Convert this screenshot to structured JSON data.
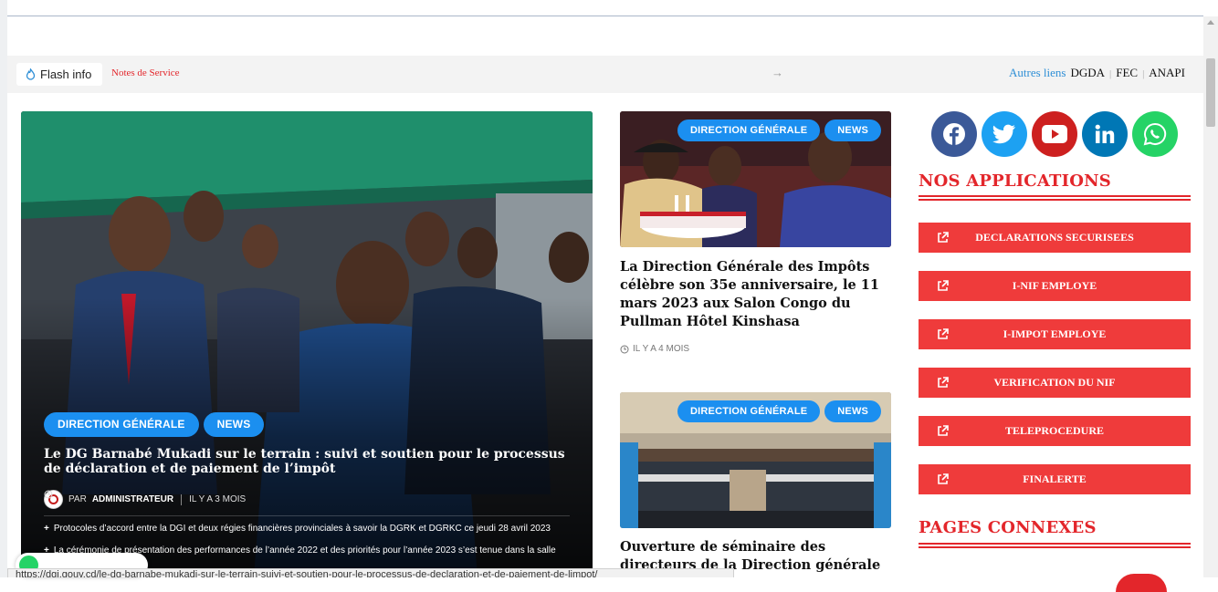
{
  "flash": {
    "label": "Flash info",
    "notes_link": "Notes de Service",
    "next_arrow": "→"
  },
  "links": {
    "label": "Autres liens",
    "items": [
      "DGDA",
      "FEC",
      "ANAPI"
    ],
    "separator": "|"
  },
  "hero": {
    "tags": [
      "DIRECTION GÉNÉRALE",
      "NEWS"
    ],
    "title": "Le DG Barnabé Mukadi sur le terrain : suivi et soutien pour le processus de déclaration et de paiement de l’impôt",
    "by_prefix": "PAR",
    "author": "ADMINISTRATEUR",
    "time": "IL Y A 3 MOIS",
    "related": [
      "Protocoles d’accord entre la DGI et deux régies financières provinciales à savoir la DGRK et DGRKC ce jeudi 28 avril 2023",
      "La cérémonie de présentation des performances de l’année 2022 et des priorités pour l’année 2023 s’est tenue dans la salle"
    ]
  },
  "cards": [
    {
      "tags": [
        "DIRECTION GÉNÉRALE",
        "NEWS"
      ],
      "title": "La Direction Générale des Impôts célèbre son 35e anniversaire, le 11 mars 2023 aux Salon Congo du Pullman Hôtel Kinshasa",
      "time": "IL Y A 4 MOIS"
    },
    {
      "tags": [
        "DIRECTION GÉNÉRALE",
        "NEWS"
      ],
      "title": "Ouverture de séminaire des directeurs de la Direction générale"
    }
  ],
  "social": [
    {
      "icon": "facebook-icon",
      "color": "#3b5998"
    },
    {
      "icon": "twitter-icon",
      "color": "#1da1f2"
    },
    {
      "icon": "youtube-icon",
      "color": "#cd201f"
    },
    {
      "icon": "linkedin-icon",
      "color": "#0077b5"
    },
    {
      "icon": "whatsapp-icon",
      "color": "#25d366"
    }
  ],
  "applications": {
    "heading": "NOS APPLICATIONS",
    "items": [
      "DECLARATIONS SECURISEES",
      "I-NIF EMPLOYE",
      "I-IMPOT EMPLOYE",
      "VERIFICATION DU NIF",
      "TELEPROCEDURE",
      "FINALERTE"
    ]
  },
  "pages_connexes": {
    "heading": "PAGES CONNEXES"
  },
  "status_url": "https://dgi.gouv.cd/le-dg-barnabe-mukadi-sur-le-terrain-suivi-et-soutien-pour-le-processus-de-declaration-et-de-paiement-de-limpot/",
  "colors": {
    "accent": "#e3262b",
    "tag_blue": "#1b8ff0",
    "button_red": "#ef3b3b"
  }
}
